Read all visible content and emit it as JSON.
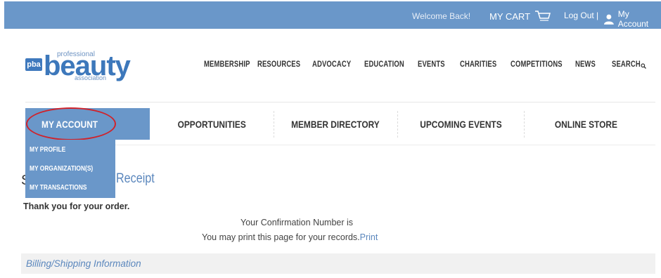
{
  "topbar": {
    "welcome": "Welcome Back!",
    "cart_label": "MY CART",
    "logout_label": "Log Out |",
    "account_label": "My Account"
  },
  "logo": {
    "badge": "pba",
    "professional": "professional",
    "beauty": "beauty",
    "association": "association"
  },
  "mainnav": {
    "items": [
      "MEMBERSHIP",
      "RESOURCES",
      "ADVOCACY",
      "EDUCATION",
      "EVENTS",
      "CHARITIES",
      "COMPETITIONS",
      "NEWS",
      "SEARCH"
    ]
  },
  "subnav": {
    "items": [
      "MY ACCOUNT",
      "OPPORTUNITIES",
      "MEMBER DIRECTORY",
      "UPCOMING EVENTS",
      "ONLINE STORE"
    ]
  },
  "dropdown": {
    "items": [
      "MY PROFILE",
      "MY ORGANIZATION(S)",
      "MY TRANSACTIONS"
    ]
  },
  "page": {
    "heading_start": "S",
    "heading_end": "Receipt",
    "thank_you": "Thank you for your order.",
    "confirmation": "Your Confirmation Number is",
    "print_text": "You may print this page for your records.",
    "print_link": "Print",
    "billing_section": "Billing/Shipping Information"
  },
  "colors": {
    "brand_blue": "#6a97c9",
    "link_blue": "#5b87bd",
    "highlight_red": "#d0222a"
  },
  "icons": {
    "cart": "cart-icon",
    "user": "user-icon",
    "search": "search-icon"
  }
}
